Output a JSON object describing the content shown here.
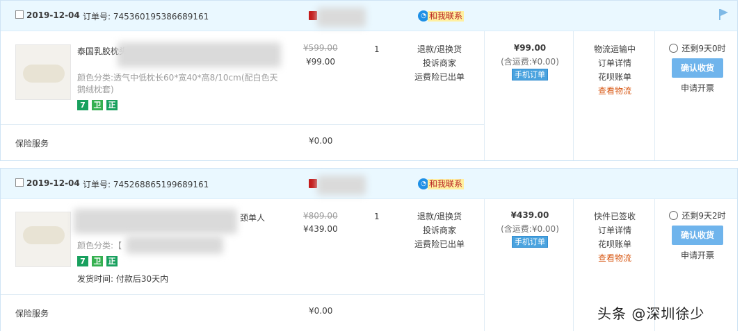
{
  "orders": [
    {
      "date": "2019-12-04",
      "order_label": "订单号:",
      "order_no": "745360195386689161",
      "chat_label": "和我联系",
      "item": {
        "title": "泰国乳胶枕头",
        "sku": "颜色分类:透气中低枕长60*宽40*高8/10cm(配白色天鹅绒枕套)",
        "badges": [
          "7",
          "卫",
          "正"
        ],
        "orig_price": "¥599.00",
        "price": "¥99.00",
        "qty": "1"
      },
      "ops": [
        "退款/退换货",
        "投诉商家",
        "运费险已出单"
      ],
      "pay_amount": "¥99.00",
      "pay_ship": "(含运费:¥0.00)",
      "mobile_tag": "手机订单",
      "status": [
        "物流运输中",
        "订单详情",
        "花呗账单"
      ],
      "logistics": "查看物流",
      "timer": "还剩9天0时",
      "confirm": "确认收货",
      "invoice": "申请开票",
      "insurance": "保险服务",
      "insurance_amt": "¥0.00"
    },
    {
      "date": "2019-12-04",
      "order_label": "订单号:",
      "order_no": "745268865199689161",
      "chat_label": "和我联系",
      "item": {
        "title": "颈单人",
        "sku": "颜色分类:【",
        "badges": [
          "7",
          "卫",
          "正"
        ],
        "ship_time": "发货时间: 付款后30天内",
        "orig_price": "¥809.00",
        "price": "¥439.00",
        "qty": "1"
      },
      "ops": [
        "退款/退换货",
        "投诉商家",
        "运费险已出单"
      ],
      "pay_amount": "¥439.00",
      "pay_ship": "(含运费:¥0.00)",
      "mobile_tag": "手机订单",
      "status": [
        "快件已签收",
        "订单详情",
        "花呗账单"
      ],
      "logistics": "查看物流",
      "timer": "还剩9天2时",
      "confirm": "确认收货",
      "invoice": "申请开票",
      "insurance": "保险服务",
      "insurance_amt": "¥0.00"
    }
  ],
  "watermark": "头条 @深圳徐少",
  "colors": {
    "header_bg": "#eaf8ff",
    "confirm_btn": "#6fb4ec",
    "logistics_link": "#d85a17",
    "chat_badge": "#fff0a0"
  }
}
